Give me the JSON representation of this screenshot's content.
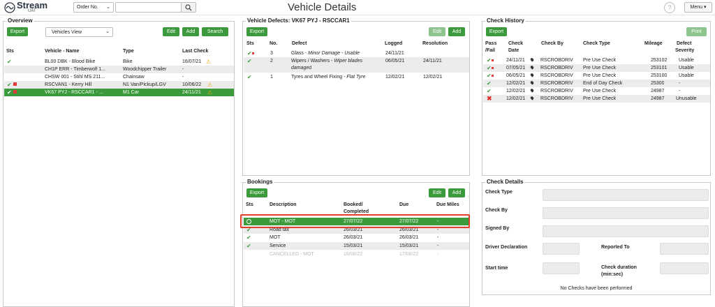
{
  "header": {
    "logo_text": "Stream",
    "logo_sub": "UAT",
    "search_type": "Order No.",
    "search_value": "",
    "page_title": "Vehicle Details",
    "help_symbol": "?",
    "menu_label": "Menu ▾"
  },
  "overview": {
    "title": "Overview",
    "export_label": "Export",
    "view_select": "Vehicles View",
    "edit_label": "Edit",
    "add_label": "Add",
    "search_label": "Search",
    "columns": {
      "sts": "Sts",
      "name": "Vehicle - Name",
      "type": "Type",
      "last_check": "Last Check"
    },
    "rows": [
      {
        "name": "BL00 DBK - Blood Bike",
        "type": "Bike",
        "last_check": "16/07/21"
      },
      {
        "name": "CH1P ERR - Timberwolf 1...",
        "type": "Woodchipper Trailer",
        "last_check": "-"
      },
      {
        "name": "CHSW 001 - Stihl MS 211...",
        "type": "Chainsaw",
        "last_check": "-"
      },
      {
        "name": "RSCVAN1 - Kerry Hill",
        "type": "N1 Van/Pickup/LGV",
        "last_check": "10/06/22"
      },
      {
        "name": "VK67 PYJ - RSCCAR1 - ...",
        "type": "M1 Car",
        "last_check": "24/11/21"
      }
    ]
  },
  "defects": {
    "title": "Vehicle Defects: VK67 PYJ - RSCCAR1",
    "export_label": "Export",
    "edit_label": "Edit",
    "add_label": "Add",
    "columns": {
      "sts": "Sts",
      "no": "No.",
      "defect": "Defect",
      "logged": "Logged",
      "resolution": "Resolution"
    },
    "rows": [
      {
        "no": "3",
        "defect": "Glass - ",
        "defect_note": "Minor Damage - Usable",
        "logged": "24/11/21",
        "resolution": ""
      },
      {
        "no": "2",
        "defect": "Wipers / Washers - ",
        "defect_note": "Wiper blades",
        "defect_note2": "damaged",
        "logged": "06/05/21",
        "resolution": "24/11/21"
      },
      {
        "no": "1",
        "defect": "Tyres and Wheel Fixing - ",
        "defect_note": "Flat Tyre",
        "logged": "12/02/21",
        "resolution": "12/02/21"
      }
    ]
  },
  "bookings": {
    "title": "Bookings",
    "export_label": "Export",
    "edit_label": "Edit",
    "add_label": "Add",
    "columns": {
      "sts": "Sts",
      "description": "Description",
      "booked": "Booked/",
      "completed": "Completed",
      "due": "Due",
      "due_miles": "Due Miles"
    },
    "rows": [
      {
        "description": "MOT - MOT",
        "booked": "27/07/22",
        "due": "27/07/22",
        "due_miles": "-"
      },
      {
        "description": "Road tax",
        "booked": "26/03/21",
        "due": "26/03/21",
        "due_miles": "-"
      },
      {
        "description": "MOT",
        "booked": "26/03/21",
        "due": "26/03/21",
        "due_miles": "-"
      },
      {
        "description": "Service",
        "booked": "15/03/21",
        "due": "15/03/21",
        "due_miles": "-"
      },
      {
        "description": "CANCELLED - MOT",
        "booked": "16/08/22",
        "due": "17/08/22",
        "due_miles": "-"
      }
    ]
  },
  "history": {
    "title": "Check History",
    "export_label": "Export",
    "print_label": "Print",
    "columns": {
      "pass1": "Pass",
      "pass2": "/Fail",
      "date1": "Check",
      "date2": "Date",
      "by": "Check By",
      "type": "Check Type",
      "mileage": "Mileage",
      "sev1": "Defect",
      "sev2": "Severity"
    },
    "rows": [
      {
        "date": "24/11/21",
        "by": "RSCROBDRIV",
        "type": "Pre Use Check",
        "mileage": "253102",
        "severity": "Usable"
      },
      {
        "date": "07/05/21",
        "by": "RSCROBDRIV",
        "type": "Pre Use Check",
        "mileage": "253101",
        "severity": "Usable"
      },
      {
        "date": "06/05/21",
        "by": "RSCROBDRIV",
        "type": "Pre Use Check",
        "mileage": "253100",
        "severity": "Usable"
      },
      {
        "date": "12/02/21",
        "by": "RSCROBDRIV",
        "type": "End of Day Check",
        "mileage": "25300",
        "severity": "-"
      },
      {
        "date": "12/02/21",
        "by": "RSCROBDRIV",
        "type": "Pre Use Check",
        "mileage": "24987",
        "severity": "-"
      },
      {
        "date": "12/02/21",
        "by": "RSCROBDRIV",
        "type": "Pre Use Check",
        "mileage": "24987",
        "severity": "Unusable"
      }
    ]
  },
  "details": {
    "title": "Check Details",
    "check_type": "Check Type",
    "check_by": "Check By",
    "signed_by": "Signed By",
    "driver_decl": "Driver Declaration",
    "reported_to": "Reported To",
    "start_time": "Start time",
    "duration1": "Check duration",
    "duration2": "(min:sec)",
    "empty_msg": "No Checks have been performed"
  },
  "icons": {
    "check": "✔",
    "warn": "⚠",
    "cross": "✖",
    "search": "⌕"
  }
}
